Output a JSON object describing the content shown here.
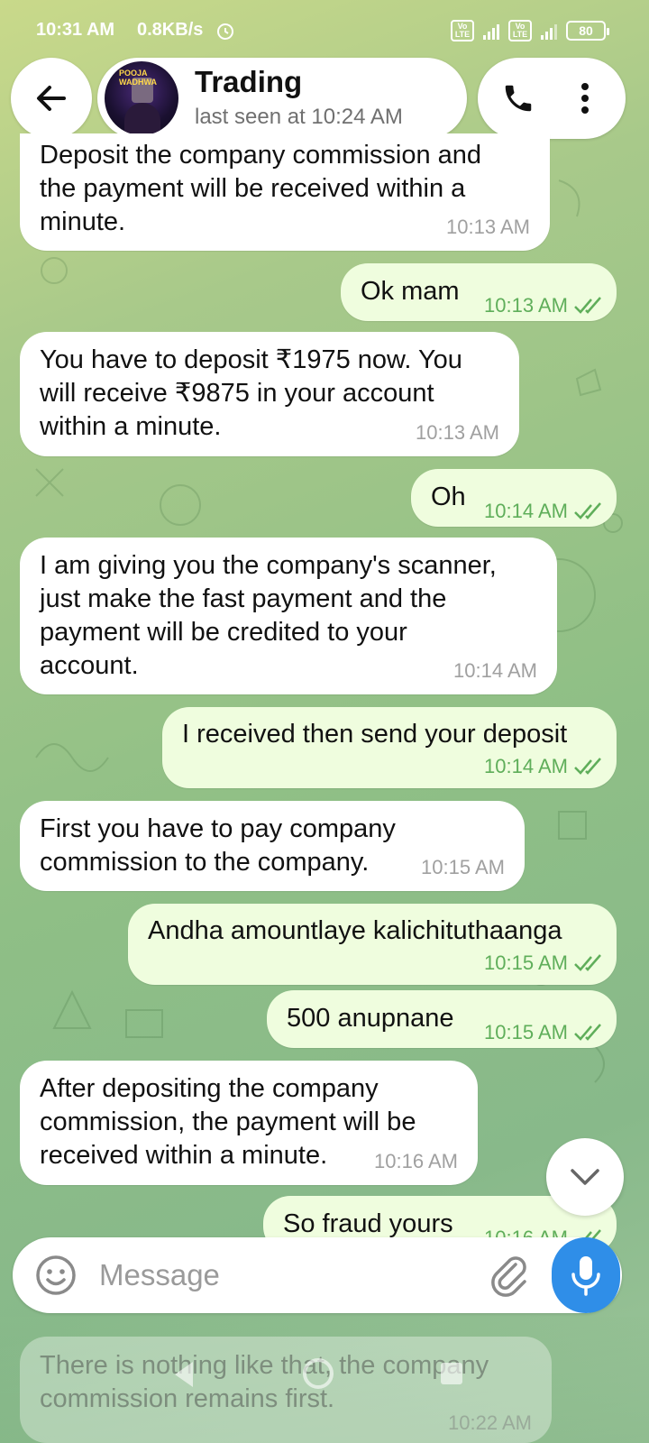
{
  "status_bar": {
    "time": "10:31 AM",
    "net_speed": "0.8KB/s",
    "network": "4G",
    "sim_label": "Vo LTE",
    "battery": "80"
  },
  "header": {
    "title": "Trading",
    "subtitle": "last seen at 10:24 AM",
    "avatar_text": "POOJA WADHWA"
  },
  "messages": [
    {
      "dir": "in",
      "text": [
        "Deposit the company commission and",
        "the payment will be received within a",
        "minute."
      ],
      "time": "10:13 AM"
    },
    {
      "dir": "out",
      "text": [
        "Ok mam"
      ],
      "time": "10:13 AM",
      "read": true
    },
    {
      "dir": "in",
      "text": [
        "You have to deposit ₹1975 now. You",
        "will receive ₹9875 in your account",
        "within a minute."
      ],
      "time": "10:13 AM"
    },
    {
      "dir": "out",
      "text": [
        "Oh"
      ],
      "time": "10:14 AM",
      "read": true
    },
    {
      "dir": "in",
      "text": [
        "I am giving you the company's scanner,",
        "just make the fast payment and the",
        "payment will be credited to your",
        "account."
      ],
      "time": "10:14 AM"
    },
    {
      "dir": "out",
      "text": [
        "I received then send your deposit"
      ],
      "time": "10:14 AM",
      "read": true
    },
    {
      "dir": "in",
      "text": [
        "First you have to pay company",
        "commission to the company."
      ],
      "time": "10:15 AM"
    },
    {
      "dir": "out",
      "text": [
        "Andha amountlaye kalichituthaanga"
      ],
      "time": "10:15 AM",
      "read": true
    },
    {
      "dir": "out",
      "text": [
        "500 anupnane"
      ],
      "time": "10:15 AM",
      "read": true
    },
    {
      "dir": "in",
      "text": [
        "After depositing the company",
        "commission, the payment will be",
        "received within a minute."
      ],
      "time": "10:16 AM"
    },
    {
      "dir": "out",
      "text": [
        "So fraud yours"
      ],
      "time": "10:16 AM",
      "read": true
    }
  ],
  "composer": {
    "placeholder": "Message"
  },
  "ghost_message": {
    "text": [
      "There is nothing like that, the company",
      "commission remains first."
    ],
    "time": "10:22 AM"
  },
  "icons": {
    "back": "arrow-left-icon",
    "call": "phone-icon",
    "more": "more-vertical-icon",
    "emoji": "smiley-icon",
    "attach": "paperclip-icon",
    "mic": "microphone-icon",
    "scroll": "chevron-down-icon"
  },
  "colors": {
    "incoming_bubble": "#ffffff",
    "outgoing_bubble": "#effdde",
    "outgoing_meta": "#5fae5a",
    "mic_button": "#2f8ee8"
  }
}
